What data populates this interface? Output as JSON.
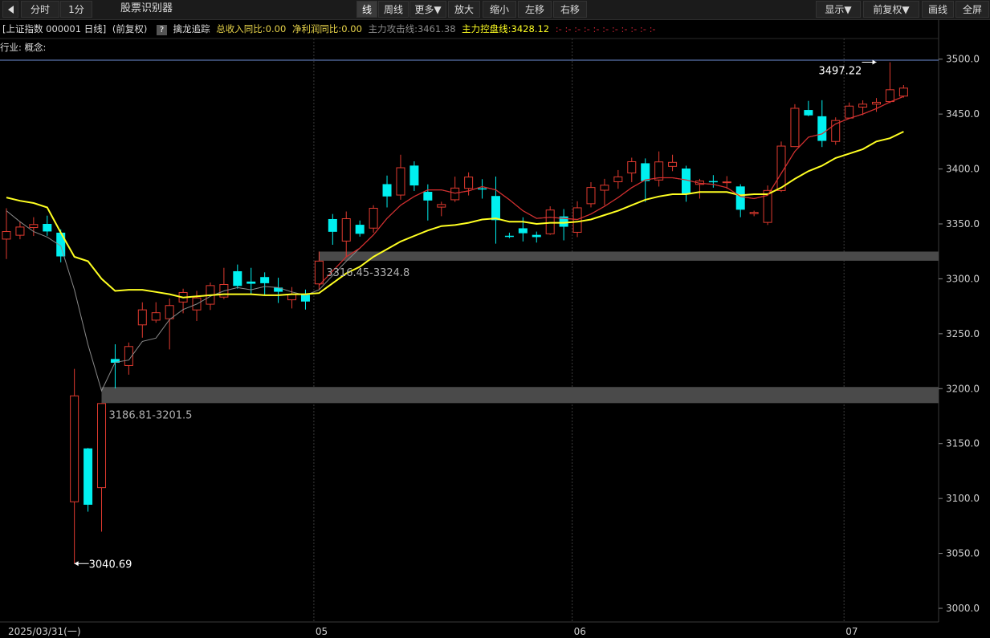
{
  "toolbar": {
    "left_buttons": [
      "分时",
      "1分"
    ],
    "title": "股票识别器",
    "center_buttons": [
      "线",
      "周线",
      "更多▼",
      "放大",
      "缩小",
      "左移",
      "右移"
    ],
    "right_buttons": [
      "显示▼",
      "前复权▼",
      "画线",
      "全屏"
    ]
  },
  "info": {
    "index_label": "[上证指数 000001 日线]",
    "adjust_label": "(前复权)",
    "help_icon": "?",
    "tracking": "擒龙追踪",
    "revenue": "总收入同比:0.00",
    "profit": "净利润同比:0.00",
    "attack_line": "主力攻击线:3461.38",
    "control_line": "主力控盘线:3428.12",
    "indicator_dots": ":-  :-  :-  :-  :-  :-  :-  :-  :-  :-  :-"
  },
  "industry_label": "行业: 概念:",
  "chart_data": {
    "type": "candlestick",
    "y_ticks": [
      3000.0,
      3050.0,
      3100.0,
      3150.0,
      3200.0,
      3250.0,
      3300.0,
      3350.0,
      3400.0,
      3450.0,
      3500.0
    ],
    "ylim": [
      3000,
      3510
    ],
    "x_labels": [
      {
        "text": "2025/03/31(一)",
        "index": 0
      },
      {
        "text": "05",
        "index": 23
      },
      {
        "text": "06",
        "index": 42
      },
      {
        "text": "07",
        "index": 62
      }
    ],
    "candles": [
      [
        3335.8,
        3343.4,
        3318.0,
        3364.2
      ],
      [
        3339.3,
        3347.5,
        3336.0,
        3352.3
      ],
      [
        3346.3,
        3349.8,
        3339.0,
        3356.1
      ],
      [
        3350.0,
        3343.1,
        3339.2,
        3357.5
      ],
      [
        3342.0,
        3320.4,
        3315.0,
        3345.0
      ],
      [
        3096.6,
        3193.8,
        3040.7,
        3218.0
      ],
      [
        3145.6,
        3094.3,
        3088.0,
        3146.0
      ],
      [
        3109.5,
        3186.8,
        3069.8,
        3186.8
      ],
      [
        3227.0,
        3223.6,
        3200.3,
        3240.4
      ],
      [
        3220.7,
        3238.7,
        3212.7,
        3242.0
      ],
      [
        3257.7,
        3272.1,
        3246.4,
        3278.6
      ],
      [
        3262.0,
        3269.5,
        3260.0,
        3278.7
      ],
      [
        3263.3,
        3276.0,
        3235.7,
        3282.0
      ],
      [
        3278.5,
        3287.9,
        3268.6,
        3291.0
      ],
      [
        3271.3,
        3283.0,
        3261.6,
        3289.0
      ],
      [
        3276.5,
        3294.2,
        3271.6,
        3296.6
      ],
      [
        3283.0,
        3295.2,
        3281.5,
        3310.0
      ],
      [
        3306.9,
        3293.5,
        3291.0,
        3313.0
      ],
      [
        3297.5,
        3295.5,
        3285.7,
        3310.0
      ],
      [
        3301.6,
        3296.0,
        3285.0,
        3305.9
      ],
      [
        3292.0,
        3288.2,
        3278.0,
        3301.0
      ],
      [
        3280.5,
        3286.0,
        3273.0,
        3292.5
      ],
      [
        3285.5,
        3279.3,
        3272.0,
        3290.2
      ],
      [
        3295.0,
        3316.5,
        3290.0,
        3324.8
      ],
      [
        3354.4,
        3342.8,
        3331.0,
        3359.0
      ],
      [
        3334.0,
        3355.1,
        3320.0,
        3361.3
      ],
      [
        3349.2,
        3341.0,
        3338.4,
        3353.1
      ],
      [
        3345.8,
        3364.6,
        3342.0,
        3367.0
      ],
      [
        3386.2,
        3375.0,
        3365.0,
        3394.0
      ],
      [
        3375.9,
        3401.5,
        3372.0,
        3413.0
      ],
      [
        3403.1,
        3385.0,
        3380.0,
        3407.0
      ],
      [
        3379.2,
        3371.3,
        3353.1,
        3386.0
      ],
      [
        3364.9,
        3368.0,
        3357.0,
        3370.2
      ],
      [
        3371.6,
        3383.0,
        3370.0,
        3393.0
      ],
      [
        3382.0,
        3393.0,
        3375.9,
        3396.9
      ],
      [
        3382.4,
        3381.9,
        3373.0,
        3390.7
      ],
      [
        3375.4,
        3353.4,
        3332.0,
        3393.1
      ],
      [
        3339.2,
        3338.5,
        3337.0,
        3342.0
      ],
      [
        3346.0,
        3341.5,
        3334.0,
        3356.0
      ],
      [
        3340.0,
        3338.0,
        3333.0,
        3343.0
      ],
      [
        3340.6,
        3363.0,
        3340.0,
        3366.0
      ],
      [
        3356.8,
        3347.4,
        3335.0,
        3363.5
      ],
      [
        3342.0,
        3365.0,
        3338.0,
        3370.6
      ],
      [
        3368.0,
        3383.5,
        3365.0,
        3388.0
      ],
      [
        3380.3,
        3385.6,
        3367.0,
        3391.0
      ],
      [
        3388.0,
        3393.2,
        3382.0,
        3399.0
      ],
      [
        3396.0,
        3407.0,
        3388.0,
        3410.3
      ],
      [
        3405.2,
        3389.0,
        3370.0,
        3409.6
      ],
      [
        3389.6,
        3406.8,
        3384.0,
        3416.0
      ],
      [
        3402.0,
        3406.4,
        3398.0,
        3413.0
      ],
      [
        3400.4,
        3377.2,
        3370.2,
        3403.0
      ],
      [
        3385.6,
        3389.4,
        3373.0,
        3391.0
      ],
      [
        3389.0,
        3388.1,
        3383.0,
        3394.4
      ],
      [
        3388.3,
        3388.6,
        3382.0,
        3393.5
      ],
      [
        3384.1,
        3362.9,
        3356.1,
        3386.1
      ],
      [
        3359.0,
        3360.8,
        3357.0,
        3362.0
      ],
      [
        3351.0,
        3380.8,
        3349.0,
        3385.0
      ],
      [
        3380.0,
        3421.2,
        3379.0,
        3425.0
      ],
      [
        3420.0,
        3455.6,
        3420.0,
        3459.0
      ],
      [
        3453.7,
        3448.8,
        3448.0,
        3462.0
      ],
      [
        3448.0,
        3425.6,
        3420.0,
        3462.6
      ],
      [
        3424.7,
        3444.5,
        3422.0,
        3447.0
      ],
      [
        3446.0,
        3457.6,
        3446.0,
        3460.5
      ],
      [
        3456.0,
        3459.4,
        3449.0,
        3462.5
      ],
      [
        3458.7,
        3461.1,
        3452.0,
        3464.6
      ],
      [
        3461.0,
        3472.5,
        3460.0,
        3497.2
      ],
      [
        3466.0,
        3474.0,
        3465.0,
        3476.4
      ]
    ],
    "series": [
      {
        "values": [
          3362,
          3352,
          3343,
          3338,
          3330,
          3290,
          3240,
          3198,
          3224,
          3226,
          3243,
          3246,
          3263,
          3272,
          3277,
          3284,
          3289,
          3292,
          3290,
          3293,
          3292,
          3288,
          3285,
          3290,
          3303,
          3316,
          3328,
          3340,
          3355,
          3367,
          3375,
          3381,
          3381,
          3378,
          3380,
          3384,
          3381,
          3372,
          3362,
          3355,
          3356,
          3355,
          3354,
          3359,
          3366,
          3374,
          3383,
          3390,
          3392,
          3392,
          3390,
          3387,
          3386,
          3383,
          3375,
          3373,
          3376,
          3396,
          3416,
          3429,
          3432,
          3441,
          3446,
          3450,
          3455,
          3461,
          3466
        ]
      },
      {
        "name": "主力控盘线",
        "values": [
          3374,
          3371,
          3369,
          3365,
          3342,
          3320,
          3316,
          3300,
          3289,
          3290,
          3290,
          3288,
          3286,
          3283,
          3284,
          3285,
          3286,
          3286,
          3286,
          3285,
          3285,
          3286,
          3286,
          3287,
          3296,
          3305,
          3311,
          3320,
          3327,
          3334,
          3339,
          3344,
          3348,
          3349,
          3351,
          3354,
          3355,
          3352,
          3352,
          3350,
          3351,
          3351,
          3352,
          3354,
          3358,
          3362,
          3367,
          3372,
          3375,
          3377,
          3377,
          3379,
          3379,
          3379,
          3376,
          3377,
          3377,
          3383,
          3391,
          3398,
          3403,
          3410,
          3414,
          3418,
          3425,
          3428,
          3434
        ]
      }
    ],
    "annotations": [
      {
        "text": "3040.69",
        "index": 5,
        "value": 3040.69
      },
      {
        "text": "3497.22",
        "index": 64,
        "value": 3497.22
      },
      {
        "text": "3186.81-3201.5",
        "low": 3186.81,
        "high": 3201.5,
        "from_index": 7
      },
      {
        "text": "3316.45-3324.8",
        "low": 3316.45,
        "high": 3324.8,
        "from_index": 23
      }
    ],
    "colors": {
      "up": "#e03a2f",
      "down": "#00f0f0",
      "ma5": "#d62b2b",
      "control": "#ffff22",
      "short_ma": "#8a8a8a",
      "gap": "#4a4a4a",
      "grid": "#3a3a3a",
      "top_line": "#6f8fd8"
    }
  }
}
